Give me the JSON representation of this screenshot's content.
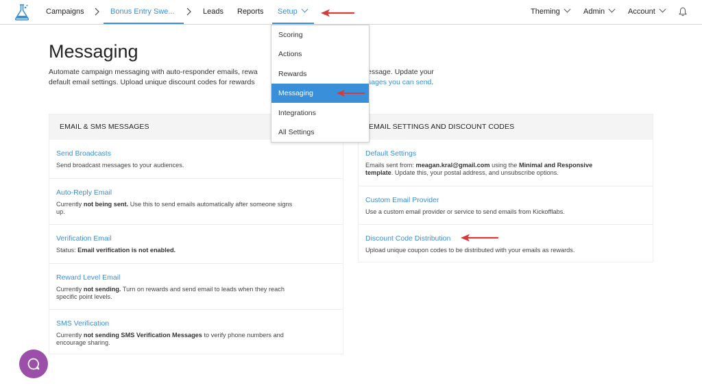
{
  "nav": {
    "campaigns": "Campaigns",
    "campaign_name": "Bonus Entry Swe...",
    "leads": "Leads",
    "reports": "Reports",
    "setup": "Setup",
    "theming": "Theming",
    "admin": "Admin",
    "account": "Account"
  },
  "dropdown": {
    "items": [
      "Scoring",
      "Actions",
      "Rewards",
      "Messaging",
      "Integrations",
      "All Settings"
    ],
    "active": "Messaging"
  },
  "page": {
    "title": "Messaging",
    "desc_line1_a": "Automate campaign messaging with auto-responder emails, rewa",
    "desc_line1_b": "essage. Update your",
    "desc_line2_a": "default email settings. Upload unique discount codes for rewards",
    "desc_line2_link": "sages you can send",
    "desc_line2_end": "."
  },
  "left_panel": {
    "header": "EMAIL & SMS MESSAGES",
    "rows": [
      {
        "title": "Send Broadcasts",
        "text": "Send broadcast messages to your audiences."
      },
      {
        "title": "Auto-Reply Email",
        "text_pre": "Currently ",
        "text_bold": "not being sent.",
        "text_post": " Use this to send emails automatically after someone signs",
        "text_line2": "up."
      },
      {
        "title": "Verification Email",
        "text_pre": "Status: ",
        "text_bold": "Email verification is not enabled."
      },
      {
        "title": "Reward Level Email",
        "text_pre": "Currently ",
        "text_bold": "not sending.",
        "text_post": " Turn on rewards and send email to leads when they reach",
        "text_line2": "specific point levels."
      },
      {
        "title": "SMS Verification",
        "text_pre": "Currently ",
        "text_bold": "not sending SMS Verification Messages",
        "text_post": " to verify phone numbers and",
        "text_line2": "encourage sharing."
      }
    ]
  },
  "right_panel": {
    "header": "EMAIL SETTINGS AND DISCOUNT CODES",
    "rows": [
      {
        "title": "Default Settings",
        "text_pre": "Emails sent from: ",
        "text_bold": "meagan.kral@gmail.com",
        "text_mid": " using the ",
        "text_bold2": "Minimal and Responsive",
        "text_line2_bold": "template",
        "text_line2": ". Update this, your postal address, and unsubscribe options."
      },
      {
        "title": "Custom Email Provider",
        "text": "Use a custom email provider or service to send emails from Kickofflabs."
      },
      {
        "title": "Discount Code Distribution",
        "text": "Upload unique coupon codes to be distributed with your emails as rewards."
      }
    ]
  },
  "colors": {
    "accent": "#3a8fd9",
    "annotation_arrow": "#d63b3b",
    "chat_bubble": "#9b4fa8"
  },
  "icons": {
    "logo": "flask-logo-icon",
    "breadcrumb_separator": "chevron-right-icon",
    "dropdown_caret": "chevron-down-icon",
    "notifications": "bell-icon",
    "chat": "chat-bubble-icon"
  }
}
